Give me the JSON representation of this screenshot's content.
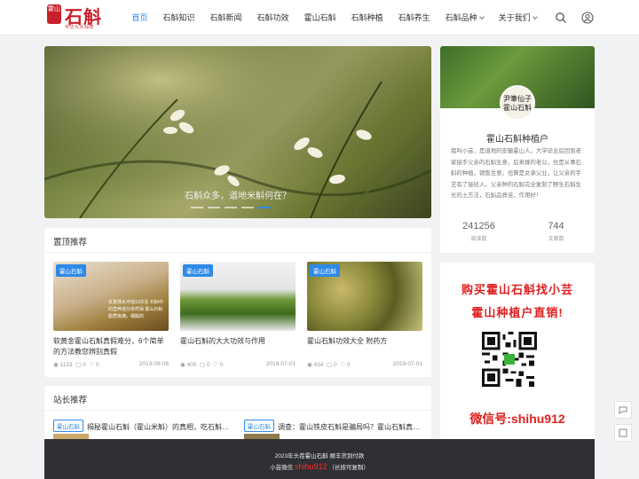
{
  "header": {
    "logo": {
      "seal_text": "霍山",
      "name": "石斛",
      "tagline": "中华九大仙草"
    },
    "nav": [
      {
        "label": "首页",
        "active": true,
        "has_dropdown": false
      },
      {
        "label": "石斛知识",
        "active": false,
        "has_dropdown": false
      },
      {
        "label": "石斛新闻",
        "active": false,
        "has_dropdown": false
      },
      {
        "label": "石斛功效",
        "active": false,
        "has_dropdown": false
      },
      {
        "label": "霍山石斛",
        "active": false,
        "has_dropdown": false
      },
      {
        "label": "石斛种植",
        "active": false,
        "has_dropdown": false
      },
      {
        "label": "石斛养生",
        "active": false,
        "has_dropdown": false
      },
      {
        "label": "石斛品种",
        "active": false,
        "has_dropdown": true
      },
      {
        "label": "关于我们",
        "active": false,
        "has_dropdown": true
      }
    ],
    "icons": [
      "search-icon",
      "user-icon"
    ]
  },
  "slider": {
    "caption": "石斛众多，道地米斛何在？",
    "slide_count": 5,
    "active_index": 4
  },
  "profile": {
    "avatar_text": "尹筆仙子 霍山石斛",
    "name": "霍山石斛种植户",
    "bio": "我叫小芸，是道地的安徽霍山人，大学毕业后回到老家接手父亲的石斛生意，后来嫁的老公，也是从事石斛的种植，销售生意，也算是女承父业，让父亲的手艺有了接班人。父亲种的石斛完全复制了野生石斛生长的土方法，石斛品质佳，作用好！",
    "stats": [
      {
        "value": "241256",
        "label": "阅读数"
      },
      {
        "value": "744",
        "label": "文章数"
      }
    ]
  },
  "ad": {
    "line1": "购买霍山石斛找小芸",
    "line2": "霍山种植户直销!",
    "wechat": "微信号:shihu912"
  },
  "pinned": {
    "title": "置顶推荐",
    "cards": [
      {
        "tag": "霍山石斛",
        "title": "软黄金霍山石斛真假难分，6个简单的方法教您辨别真假",
        "views": "1153",
        "comments": "0",
        "likes": "0",
        "date": "2019-09-08",
        "image_overlay": "反复揉水冲泡10次后 石斛中的营养成分依然保 霍山石斛胶质饱满，细腻的"
      },
      {
        "tag": "霍山石斛",
        "title": "霍山石斛的大大功效与作用",
        "views": "405",
        "comments": "0",
        "likes": "0",
        "date": "2019-07-01",
        "image_overlay": ""
      },
      {
        "tag": "霍山石斛",
        "title": "霍山石斛功效大全 附药方",
        "views": "434",
        "comments": "0",
        "likes": "0",
        "date": "2019-07-01",
        "image_overlay": ""
      }
    ]
  },
  "editor": {
    "title": "站长推荐",
    "items": [
      {
        "tag": "霍山石斛",
        "title": "揭秘霍山石斛（霍山米斛）的真相，吃石斛…"
      },
      {
        "tag": "霍山石斛",
        "title": "调查：霍山铁皮石斛是骗局吗？霍山石斛真…"
      }
    ]
  },
  "footer": {
    "line1": "2023年头茬霍山石斛 顺丰货到付款",
    "line2_prefix": "小芸微信",
    "line2_highlight": "shihu912",
    "line2_suffix": "（长按可复制）"
  },
  "colors": {
    "accent": "#2f89e8",
    "brand_red": "#c8202a",
    "ad_red": "#e02020",
    "footer_bg": "#2e3033"
  }
}
